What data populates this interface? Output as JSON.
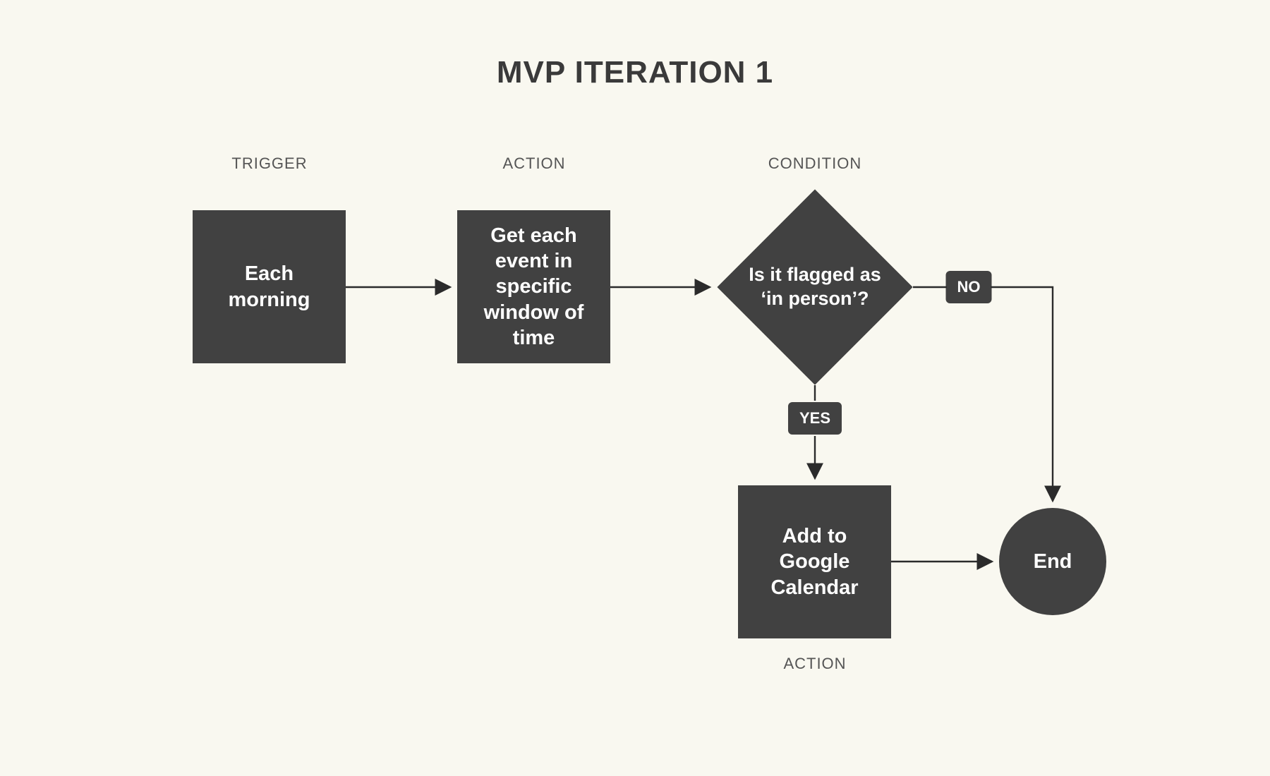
{
  "title": "MVP ITERATION 1",
  "labels": {
    "trigger": "TRIGGER",
    "action1": "ACTION",
    "condition": "CONDITION",
    "action2": "ACTION"
  },
  "nodes": {
    "trigger": "Each morning",
    "action1": "Get each event in specific window of time",
    "condition": "Is it flagged as ‘in person’?",
    "action2": "Add to Google Calendar",
    "end": "End"
  },
  "branches": {
    "yes": "YES",
    "no": "NO"
  }
}
